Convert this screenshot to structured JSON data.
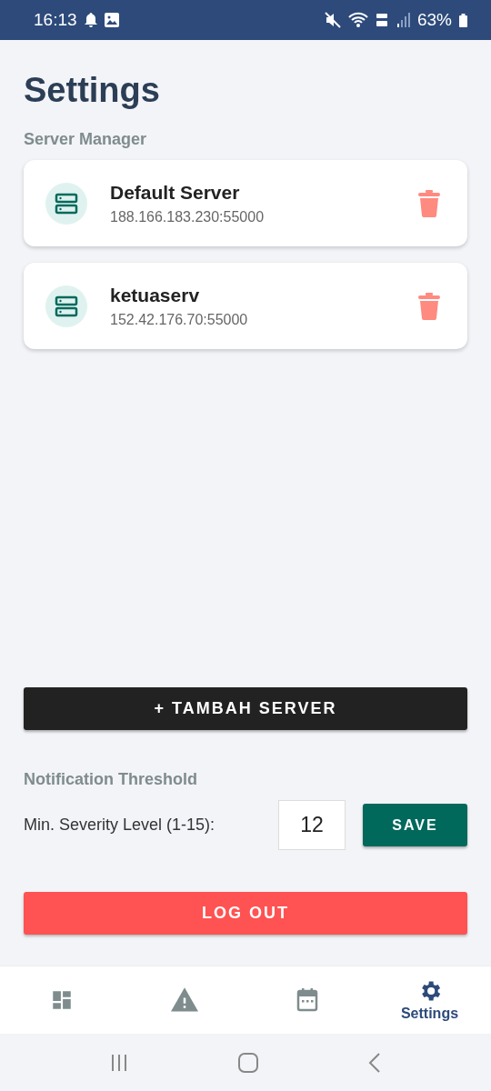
{
  "status_bar": {
    "time": "16:13",
    "battery": "63%"
  },
  "title": "Settings",
  "server_section": {
    "label": "Server Manager",
    "servers": [
      {
        "name": "Default Server",
        "address": "188.166.183.230:55000"
      },
      {
        "name": "ketuaserv",
        "address": "152.42.176.70:55000"
      }
    ]
  },
  "add_server_button": "+ TAMBAH SERVER",
  "notification": {
    "label": "Notification Threshold",
    "field_label": "Min. Severity Level (1-15):",
    "value": "12",
    "save_button": "SAVE"
  },
  "logout_button": "LOG OUT",
  "bottom_nav": [
    {
      "kind": "dashboard",
      "selected": false
    },
    {
      "kind": "alerts",
      "selected": false
    },
    {
      "kind": "calendar",
      "selected": false
    },
    {
      "kind": "settings",
      "label": "Settings",
      "selected": true
    }
  ]
}
